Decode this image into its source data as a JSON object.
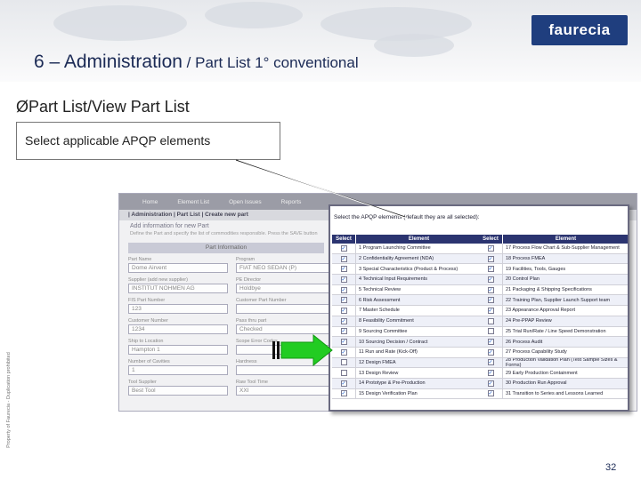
{
  "logo": {
    "text": "faurecia"
  },
  "slide": {
    "title_main": "6 – Administration",
    "title_sub": " / Part List 1° conventional",
    "bullet": "ØPart List/View Part List",
    "callout": "Select applicable APQP elements",
    "side_text": "Property of Faurecia - Duplication prohibited",
    "page_number": "32"
  },
  "app": {
    "nav": [
      "Home",
      "Element List",
      "Open Issues",
      "Reports"
    ],
    "breadcrumb": "| Administration | Part List | Create new part",
    "heading": "Add information for new Part",
    "note": "Define the Part and specify the list of commodities responsible. Press the SAVE button",
    "section": "Part Information",
    "fields_left": [
      {
        "label": "Part Name",
        "value": "Dome Airvent"
      },
      {
        "label": "Supplier (add new supplier)",
        "value": "INSTITUT NOHMEN AG"
      },
      {
        "label": "FIS Part Number",
        "value": "123"
      },
      {
        "label": "Customer Number",
        "value": "1234"
      },
      {
        "label": "Ship to Location",
        "value": "Hampton 1"
      },
      {
        "label": "Number of Cavities",
        "value": "1"
      },
      {
        "label": "Tool Supplier",
        "value": "Best Tool"
      }
    ],
    "fields_right": [
      {
        "label": "Program",
        "value": "FIAT NEO SEDAN (P)"
      },
      {
        "label": "PE Director",
        "value": "Holdbye"
      },
      {
        "label": "Customer Part Number",
        "value": ""
      },
      {
        "label": "Pass thru part",
        "value": "Checked"
      },
      {
        "label": "Scope Error Codes",
        "value": ""
      },
      {
        "label": "Hardness",
        "value": ""
      },
      {
        "label": "Raw Tool Time",
        "value": "XXI"
      }
    ]
  },
  "dialog": {
    "title": "Select the APQP elements (default they are all selected):",
    "col_select": "Select",
    "col_element": "Element",
    "left_items": [
      {
        "label": "1  Program Launching Committee",
        "checked": true
      },
      {
        "label": "2  Confidentiality Agreement (NDA)",
        "checked": true
      },
      {
        "label": "3  Special Characteristics (Product & Process)",
        "checked": true
      },
      {
        "label": "4  Technical Input Requirements",
        "checked": true
      },
      {
        "label": "5  Technical Review",
        "checked": true
      },
      {
        "label": "6  Risk Assessment",
        "checked": true
      },
      {
        "label": "7  Master Schedule",
        "checked": true
      },
      {
        "label": "8  Feasibility Commitment",
        "checked": true
      },
      {
        "label": "9  Sourcing Committee",
        "checked": true
      },
      {
        "label": "10 Sourcing Decision / Contract",
        "checked": true
      },
      {
        "label": "11 Run and Rate (Kick-Off)",
        "checked": true
      },
      {
        "label": "12 Design FMEA",
        "checked": false
      },
      {
        "label": "13 Design Review",
        "checked": false
      },
      {
        "label": "14 Prototype & Pre-Production",
        "checked": true
      },
      {
        "label": "15 Design Verification Plan",
        "checked": true
      }
    ],
    "right_items": [
      {
        "label": "17 Process Flow Chart & Sub-Supplier Management",
        "checked": true
      },
      {
        "label": "18 Process FMEA",
        "checked": true
      },
      {
        "label": "19 Facilities, Tools, Gauges",
        "checked": true
      },
      {
        "label": "20 Control Plan",
        "checked": true
      },
      {
        "label": "21 Packaging & Shipping Specifications",
        "checked": true
      },
      {
        "label": "22 Training Plan, Supplier Launch Support team",
        "checked": true
      },
      {
        "label": "23 Appearance Approval Report",
        "checked": true
      },
      {
        "label": "24 Pre-PPAP Review",
        "checked": false
      },
      {
        "label": "25 Trial Run/Rate / Line Speed Demonstration",
        "checked": false
      },
      {
        "label": "26 Process Audit",
        "checked": true
      },
      {
        "label": "27 Process Capability Study",
        "checked": true
      },
      {
        "label": "28 Production Validation Plan (Test Sample Sizes & Forms)",
        "checked": true
      },
      {
        "label": "29 Early Production Containment",
        "checked": true
      },
      {
        "label": "30 Production Run Approval",
        "checked": true
      },
      {
        "label": "31 Transition to Series and Lessons Learned",
        "checked": true
      }
    ]
  },
  "colors": {
    "title": "#1b2a55",
    "logo_bg": "#1f3e7e",
    "grid_header": "#2b3470",
    "arrow": "#22cc22"
  }
}
